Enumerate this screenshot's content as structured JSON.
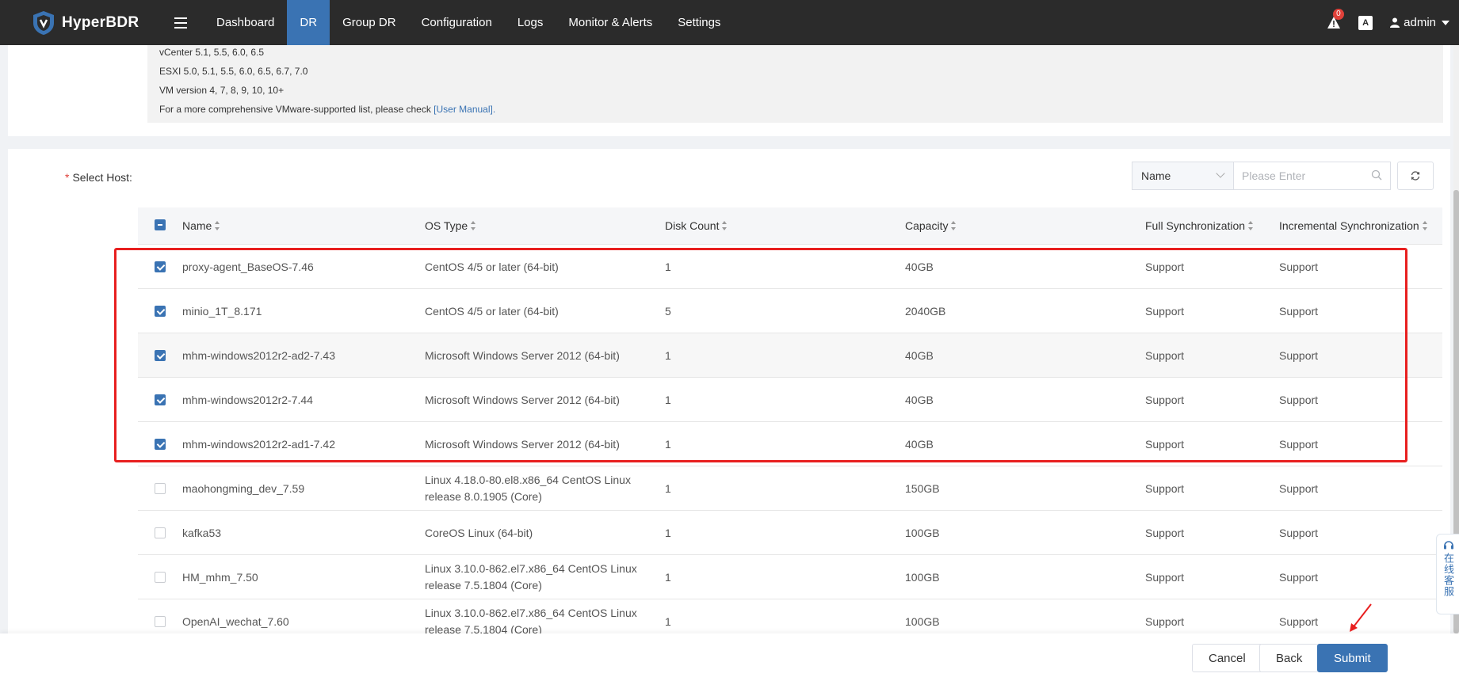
{
  "app": {
    "name": "HyperBDR"
  },
  "nav": [
    {
      "label": "Dashboard",
      "active": false
    },
    {
      "label": "DR",
      "active": true
    },
    {
      "label": "Group DR",
      "active": false
    },
    {
      "label": "Configuration",
      "active": false
    },
    {
      "label": "Logs",
      "active": false
    },
    {
      "label": "Monitor & Alerts",
      "active": false
    },
    {
      "label": "Settings",
      "active": false
    }
  ],
  "header": {
    "alert_count": "0",
    "lang_label": "A",
    "user_name": "admin"
  },
  "info": {
    "lines": [
      "vCenter 5.1, 5.5, 6.0, 6.5",
      "ESXI 5.0, 5.1, 5.5, 6.0, 6.5, 6.7, 7.0",
      "VM version 4, 7, 8, 9, 10, 10+"
    ],
    "manual_text": "For a more comprehensive VMware-supported list, please check ",
    "manual_link": "[User Manual]."
  },
  "hosts": {
    "required_mark": "*",
    "label": "Select Host:",
    "filter_field": "Name",
    "search_placeholder": "Please Enter",
    "columns": [
      "Name",
      "OS Type",
      "Disk Count",
      "Capacity",
      "Full Synchronization",
      "Incremental Synchronization"
    ],
    "rows": [
      {
        "checked": true,
        "name": "proxy-agent_BaseOS-7.46",
        "os": "CentOS 4/5 or later (64-bit)",
        "disks": "1",
        "capacity": "40GB",
        "full": "Support",
        "incr": "Support"
      },
      {
        "checked": true,
        "name": "minio_1T_8.171",
        "os": "CentOS 4/5 or later (64-bit)",
        "disks": "5",
        "capacity": "2040GB",
        "full": "Support",
        "incr": "Support"
      },
      {
        "checked": true,
        "name": "mhm-windows2012r2-ad2-7.43",
        "os": "Microsoft Windows Server 2012 (64-bit)",
        "disks": "1",
        "capacity": "40GB",
        "full": "Support",
        "incr": "Support"
      },
      {
        "checked": true,
        "name": "mhm-windows2012r2-7.44",
        "os": "Microsoft Windows Server 2012 (64-bit)",
        "disks": "1",
        "capacity": "40GB",
        "full": "Support",
        "incr": "Support"
      },
      {
        "checked": true,
        "name": "mhm-windows2012r2-ad1-7.42",
        "os": "Microsoft Windows Server 2012 (64-bit)",
        "disks": "1",
        "capacity": "40GB",
        "full": "Support",
        "incr": "Support"
      },
      {
        "checked": false,
        "name": "maohongming_dev_7.59",
        "os": "Linux 4.18.0-80.el8.x86_64 CentOS Linux release 8.0.1905 (Core)",
        "disks": "1",
        "capacity": "150GB",
        "full": "Support",
        "incr": "Support"
      },
      {
        "checked": false,
        "name": "kafka53",
        "os": "CoreOS Linux (64-bit)",
        "disks": "1",
        "capacity": "100GB",
        "full": "Support",
        "incr": "Support"
      },
      {
        "checked": false,
        "name": "HM_mhm_7.50",
        "os": "Linux 3.10.0-862.el7.x86_64 CentOS Linux release 7.5.1804 (Core)",
        "disks": "1",
        "capacity": "100GB",
        "full": "Support",
        "incr": "Support"
      },
      {
        "checked": false,
        "name": "OpenAI_wechat_7.60",
        "os": "Linux 3.10.0-862.el7.x86_64 CentOS Linux release 7.5.1804 (Core)",
        "disks": "1",
        "capacity": "100GB",
        "full": "Support",
        "incr": "Support"
      }
    ]
  },
  "footer": {
    "cancel": "Cancel",
    "back": "Back",
    "submit": "Submit"
  },
  "support_widget": {
    "label": "在线客服"
  },
  "colors": {
    "nav_bg": "#2b2b2b",
    "accent": "#3a73b3",
    "highlight": "#e81f1f",
    "badge": "#e0413a"
  }
}
